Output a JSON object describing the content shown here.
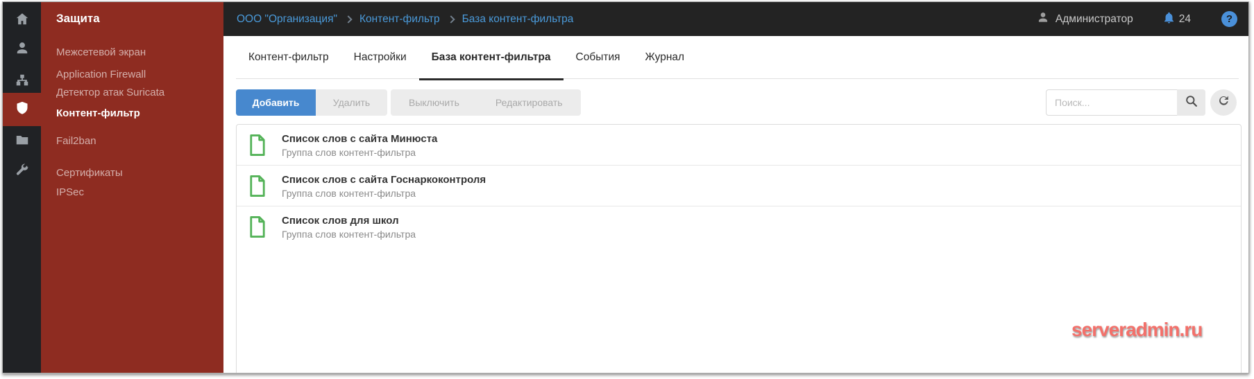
{
  "colors": {
    "brand_red": "#8e2c21",
    "topbar_dark": "#232323",
    "accent_blue": "#4788ce",
    "link_blue": "#4a9ada",
    "icon_green": "#53b257",
    "watermark_red": "#f3706a"
  },
  "iconbar": {
    "items": [
      {
        "icon": "home-icon"
      },
      {
        "icon": "users-icon"
      },
      {
        "icon": "network-icon"
      },
      {
        "icon": "shield-icon",
        "active": true
      },
      {
        "icon": "folder-icon"
      },
      {
        "icon": "wrench-icon"
      }
    ]
  },
  "sidebar": {
    "title": "Защита",
    "items": [
      {
        "label": "Межсетевой экран"
      },
      {
        "label": "Application Firewall"
      },
      {
        "label": "Детектор атак Suricata"
      },
      {
        "label": "Контент-фильтр",
        "active": true
      },
      {
        "label": "Fail2ban"
      },
      {
        "label": "Сертификаты"
      },
      {
        "label": "IPSec"
      }
    ]
  },
  "topbar": {
    "breadcrumb": {
      "items": [
        "ООО \"Организация\"",
        "Контент-фильтр",
        "База контент-фильтра"
      ]
    },
    "user_label": "Администратор",
    "notification_count": "24",
    "help_label": "?"
  },
  "tabs": {
    "items": [
      {
        "label": "Контент-фильтр"
      },
      {
        "label": "Настройки"
      },
      {
        "label": "База контент-фильтра",
        "active": true
      },
      {
        "label": "События"
      },
      {
        "label": "Журнал"
      }
    ]
  },
  "toolbar": {
    "add_label": "Добавить",
    "delete_label": "Удалить",
    "disable_label": "Выключить",
    "edit_label": "Редактировать",
    "search_placeholder": "Поиск..."
  },
  "list": {
    "items": [
      {
        "title": "Список слов с сайта Минюста",
        "subtitle": "Группа слов контент-фильтра"
      },
      {
        "title": "Список слов с сайта Госнаркоконтроля",
        "subtitle": "Группа слов контент-фильтра"
      },
      {
        "title": "Список слов для школ",
        "subtitle": "Группа слов контент-фильтра"
      }
    ]
  },
  "watermark": {
    "text": "serveradmin.ru"
  }
}
